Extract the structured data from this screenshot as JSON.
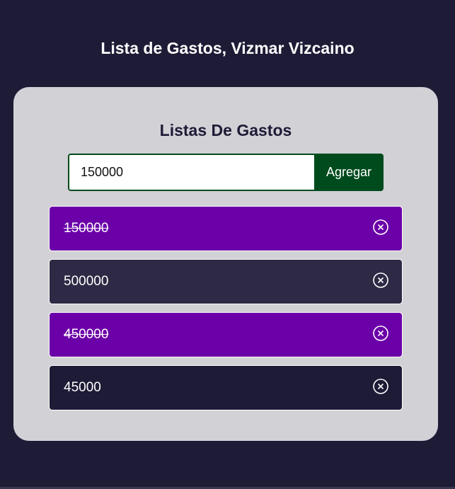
{
  "header": {
    "title": "Lista de Gastos, Vizmar Vizcaino"
  },
  "card": {
    "title": "Listas De Gastos",
    "input_value": "150000",
    "add_label": "Agregar"
  },
  "expenses": [
    {
      "amount": "150000",
      "completed": true,
      "action_icon": "close-circle-icon"
    },
    {
      "amount": "500000",
      "completed": false,
      "action_icon": "close-circle-icon"
    },
    {
      "amount": "450000",
      "completed": true,
      "action_icon": "close-circle-icon"
    },
    {
      "amount": "45000",
      "completed": false,
      "action_icon": "close-circle-icon"
    }
  ],
  "colors": {
    "background": "#1e1b36",
    "card": "#d2d1d6",
    "accent_green": "#004b1d",
    "completed_purple": "#6b00a8",
    "item_mid": "#2e2a45",
    "item_dark": "#1e1b36"
  }
}
